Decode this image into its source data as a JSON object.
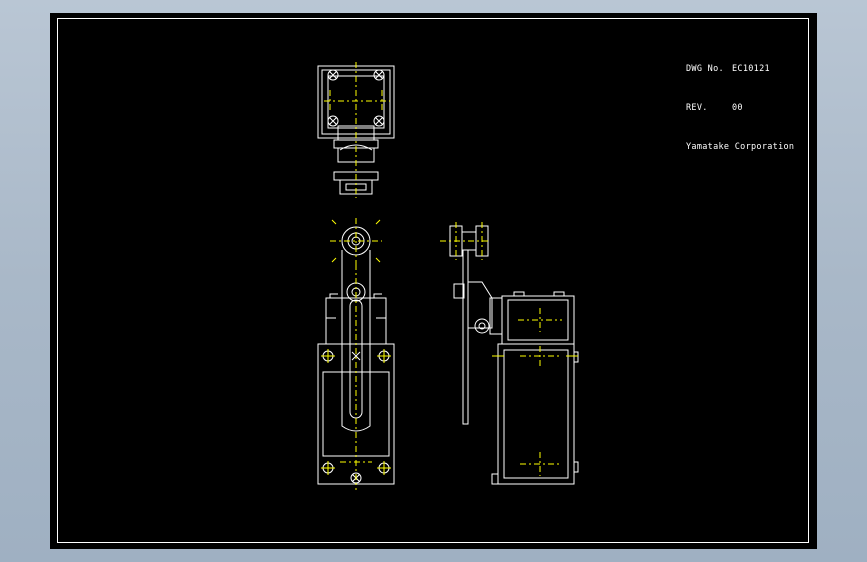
{
  "title_block": {
    "dwg_label": "DWG No.",
    "dwg_value": "EC10121",
    "rev_label": "REV.",
    "rev_value": "00",
    "company": "Yamatake Corporation"
  },
  "colors": {
    "background": "#000000",
    "outline": "#ffffff",
    "centerline": "#ffff00",
    "window_gradient": "#a9b8c8"
  }
}
